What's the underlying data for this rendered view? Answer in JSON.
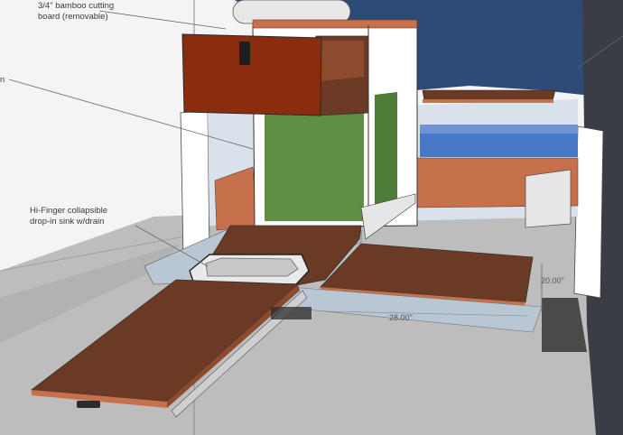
{
  "annotations": {
    "cutting_board_line1": "3/4\" bamboo cutting",
    "cutting_board_line2": "board (removable)",
    "sink_line1": "Hi-Finger collapsible",
    "sink_line2": "drop-in sink w/drain",
    "left_edge_fragment": "n"
  },
  "dimensions": {
    "width": "28.00\"",
    "depth": "20.00\""
  },
  "colors": {
    "sky": "#f4f4f4",
    "ground": "#bdbdbd",
    "wood": "#6b3a24",
    "drawer_front": "#8a2d0f",
    "cabinet_green": "#5f8f45",
    "van_blue": "#2e4a78",
    "cushion_blue": "#4a78c8",
    "panel_orange": "#c7704c"
  }
}
